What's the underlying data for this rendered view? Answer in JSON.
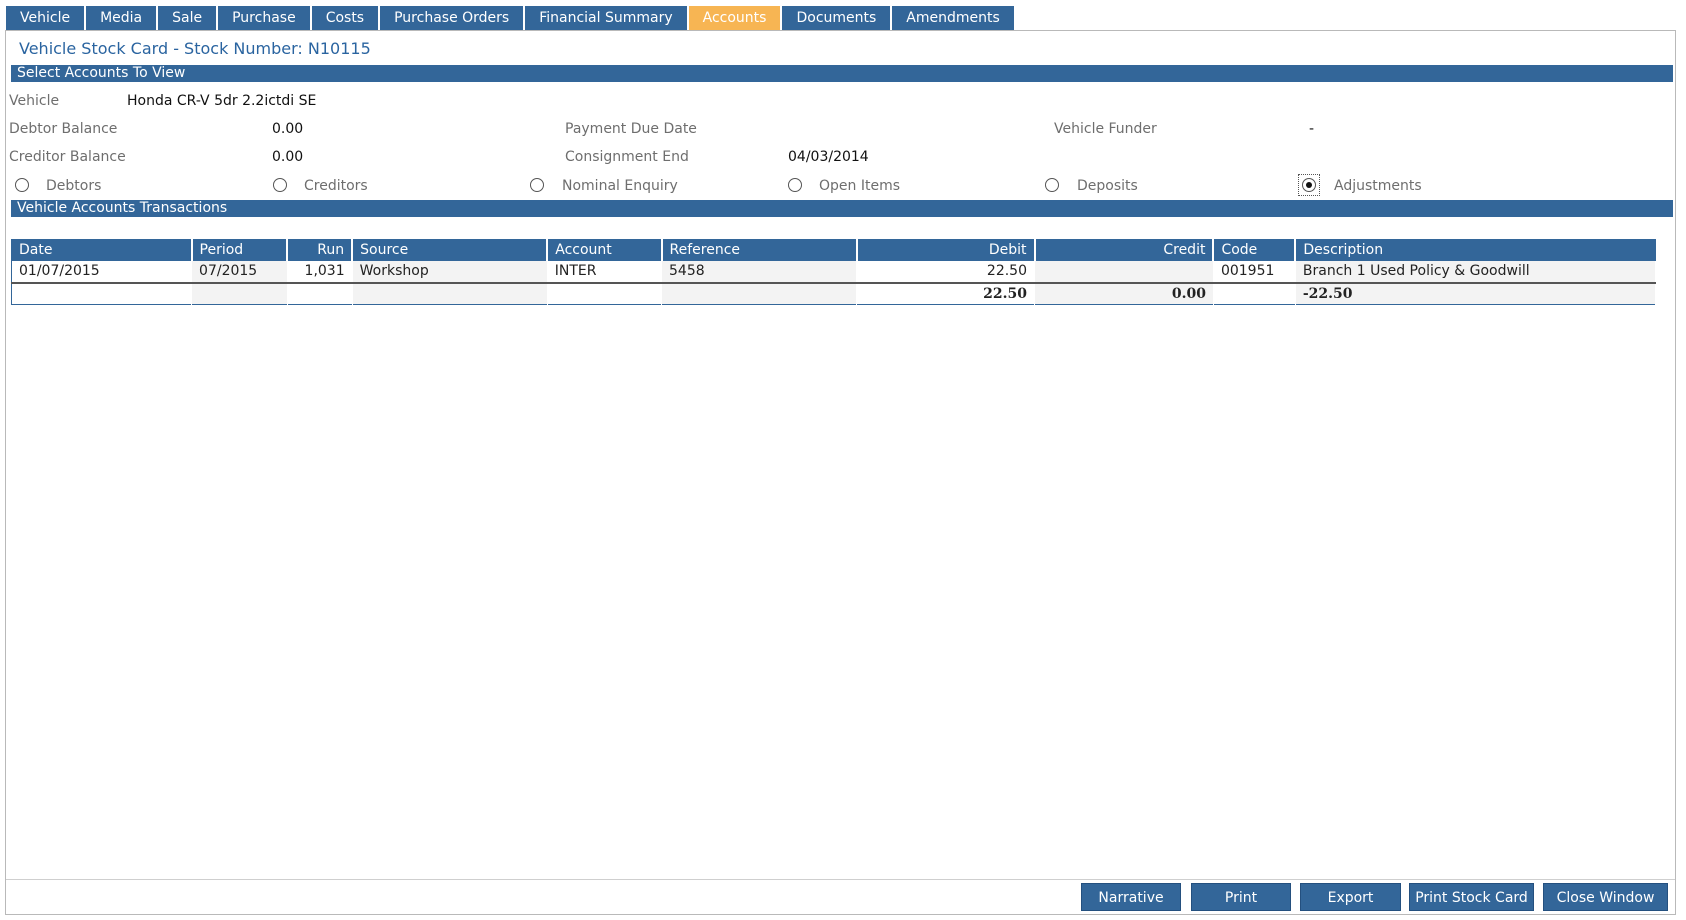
{
  "tabs": [
    {
      "label": "Vehicle",
      "active": false
    },
    {
      "label": "Media",
      "active": false
    },
    {
      "label": "Sale",
      "active": false
    },
    {
      "label": "Purchase",
      "active": false
    },
    {
      "label": "Costs",
      "active": false
    },
    {
      "label": "Purchase Orders",
      "active": false
    },
    {
      "label": "Financial Summary",
      "active": false
    },
    {
      "label": "Accounts",
      "active": true
    },
    {
      "label": "Documents",
      "active": false
    },
    {
      "label": "Amendments",
      "active": false
    }
  ],
  "title": "Vehicle Stock Card - Stock Number: N10115",
  "section_select": "Select Accounts To View",
  "info": {
    "vehicle_label": "Vehicle",
    "vehicle_value": "Honda CR-V 5dr 2.2ictdi SE",
    "debtor_label": "Debtor Balance",
    "debtor_value": "0.00",
    "creditor_label": "Creditor Balance",
    "creditor_value": "0.00",
    "payment_due_label": "Payment Due Date",
    "payment_due_value": "",
    "consignment_label": "Consignment End",
    "consignment_value": "04/03/2014",
    "funder_label": "Vehicle Funder",
    "funder_value": "-"
  },
  "radios": [
    {
      "label": "Debtors",
      "checked": false
    },
    {
      "label": "Creditors",
      "checked": false
    },
    {
      "label": "Nominal Enquiry",
      "checked": false
    },
    {
      "label": "Open Items",
      "checked": false
    },
    {
      "label": "Deposits",
      "checked": false
    },
    {
      "label": "Adjustments",
      "checked": true
    }
  ],
  "section_transactions": "Vehicle Accounts Transactions",
  "table": {
    "headers": [
      "Date",
      "Period",
      "Run",
      "Source",
      "Account",
      "Reference",
      "Debit",
      "Credit",
      "Code",
      "Description"
    ],
    "rows": [
      [
        "01/07/2015",
        "07/2015",
        "1,031",
        "Workshop",
        "INTER",
        "5458",
        "22.50",
        "",
        "001951",
        "Branch 1 Used Policy & Goodwill"
      ]
    ],
    "totals": [
      "",
      "",
      "",
      "",
      "",
      "",
      "22.50",
      "0.00",
      "",
      "-22.50"
    ]
  },
  "buttons": {
    "narrative": {
      "pre": "",
      "key": "N",
      "post": "arrative"
    },
    "print": {
      "pre": "",
      "key": "P",
      "post": "rint"
    },
    "export": {
      "pre": "",
      "key": "E",
      "post": "xport"
    },
    "print_stock_card": {
      "pre": "Print ",
      "key": "S",
      "post": "tock Card"
    },
    "close_window": {
      "pre": "Close ",
      "key": "W",
      "post": "indow"
    }
  },
  "colors": {
    "accent": "#336699",
    "active_tab": "#F7B553",
    "title": "#2a64a0"
  }
}
